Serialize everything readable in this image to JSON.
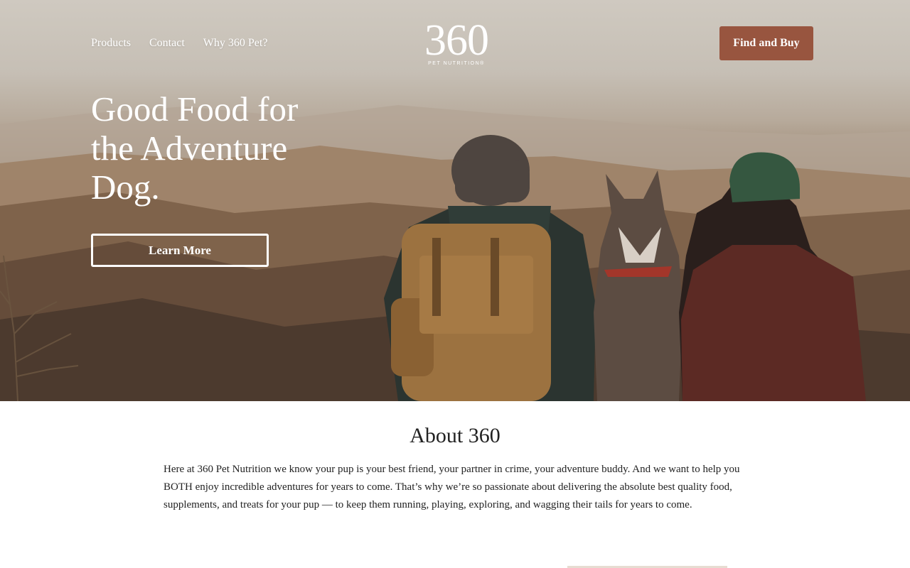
{
  "nav": {
    "items": [
      {
        "label": "Products"
      },
      {
        "label": "Contact"
      },
      {
        "label": "Why 360 Pet?"
      }
    ]
  },
  "logo": {
    "number": "360",
    "subtitle": "PET NUTRITION®"
  },
  "header": {
    "cta_label": "Find and Buy"
  },
  "hero": {
    "headline": "Good Food for the Adventure Dog.",
    "button_label": "Learn More"
  },
  "about": {
    "title": "About 360",
    "body": "Here at 360 Pet Nutrition we know your pup is your best friend, your partner in crime, your adventure buddy. And we want to help you BOTH enjoy incredible adventures for years to come. That’s why we’re so passionate about delivering the absolute best quality food, supplements, and treats for your pup — to keep them running, playing, exploring, and wagging their tails for years to come."
  },
  "colors": {
    "accent": "#98553f",
    "text": "#222222",
    "white": "#ffffff"
  }
}
